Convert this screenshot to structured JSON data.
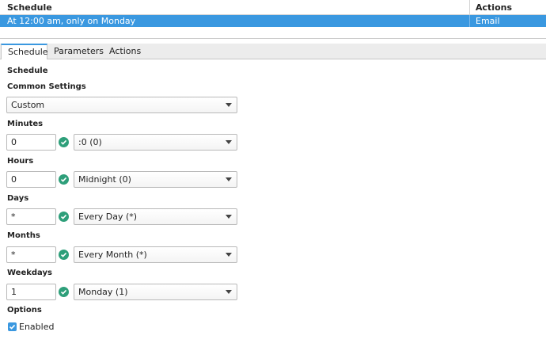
{
  "table": {
    "headers": {
      "schedule": "Schedule",
      "actions": "Actions"
    },
    "rows": [
      {
        "schedule": "At 12:00 am, only on Monday",
        "actions": "Email"
      }
    ]
  },
  "tabs": [
    {
      "label": "Schedule",
      "active": true
    },
    {
      "label": "Parameters",
      "active": false
    },
    {
      "label": "Actions",
      "active": false
    }
  ],
  "panel": {
    "section_title": "Schedule",
    "common_settings": {
      "label": "Common Settings",
      "value": "Custom"
    },
    "minutes": {
      "label": "Minutes",
      "input": "0",
      "select": ":0 (0)"
    },
    "hours": {
      "label": "Hours",
      "input": "0",
      "select": "Midnight (0)"
    },
    "days": {
      "label": "Days",
      "input": "*",
      "select": "Every Day (*)"
    },
    "months": {
      "label": "Months",
      "input": "*",
      "select": "Every Month (*)"
    },
    "weekdays": {
      "label": "Weekdays",
      "input": "1",
      "select": "Monday (1)"
    },
    "options": {
      "label": "Options",
      "enabled_label": "Enabled",
      "enabled": true
    }
  },
  "colors": {
    "accent": "#3a98e0",
    "valid": "#2e9f7a"
  }
}
